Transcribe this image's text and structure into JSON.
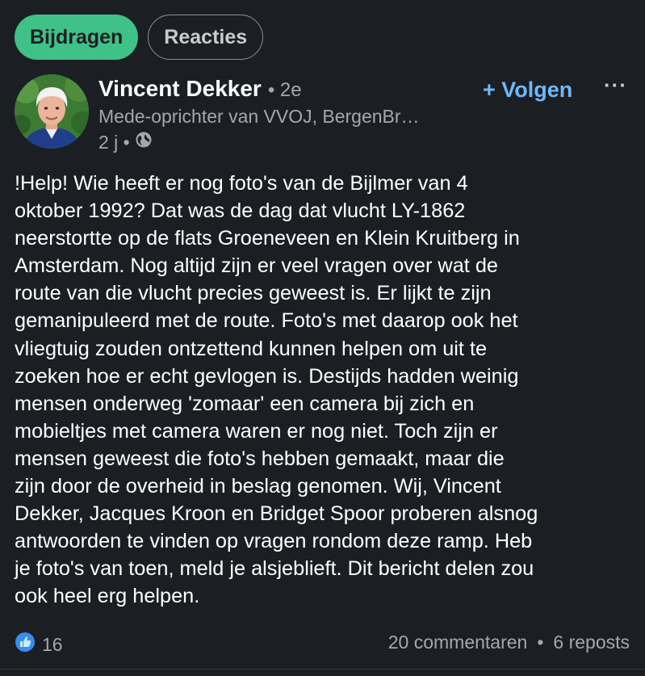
{
  "tabs": [
    {
      "label": "Bijdragen",
      "active": true
    },
    {
      "label": "Reacties",
      "active": false
    }
  ],
  "author": {
    "name": "Vincent Dekker",
    "degree": "• 2e",
    "headline": "Mede-oprichter van VVOJ, BergenBr…",
    "time": "2 j •",
    "visibility_icon": "globe-icon"
  },
  "actions": {
    "follow_label": "+ Volgen",
    "more_label": "···"
  },
  "post": {
    "text": "!Help! Wie heeft er nog foto's van de Bijlmer van 4\noktober 1992? Dat was de dag dat vlucht LY-1862\nneerstortte op de flats Groeneveen en Klein Kruitberg in\nAmsterdam. Nog altijd zijn er veel vragen over wat de\nroute van die vlucht precies geweest is. Er lijkt te zijn\ngemanipuleerd met de route. Foto's met daarop ook het\nvliegtuig zouden ontzettend kunnen helpen om uit te\nzoeken hoe er echt gevlogen is. Destijds hadden weinig\nmensen onderweg 'zomaar' een camera bij zich en\nmobieltjes met camera waren er nog niet. Toch zijn er\nmensen geweest die foto's hebben gemaakt, maar die\nzijn door de overheid in beslag genomen. Wij, Vincent\nDekker, Jacques Kroon en Bridget Spoor proberen alsnog\nantwoorden te vinden op vragen rondom deze ramp. Heb\nje foto's van toen, meld je alsjeblieft. Dit bericht delen zou\nook heel erg helpen."
  },
  "social": {
    "reaction_icon": "like-icon",
    "reaction_count": "16",
    "comments": "20 commentaren",
    "separator": "•",
    "reposts": "6 reposts"
  },
  "colors": {
    "background": "#1b1f23",
    "accent_green": "#3fc187",
    "link_blue": "#71b7fb",
    "muted_text": "#a5a8ab"
  }
}
